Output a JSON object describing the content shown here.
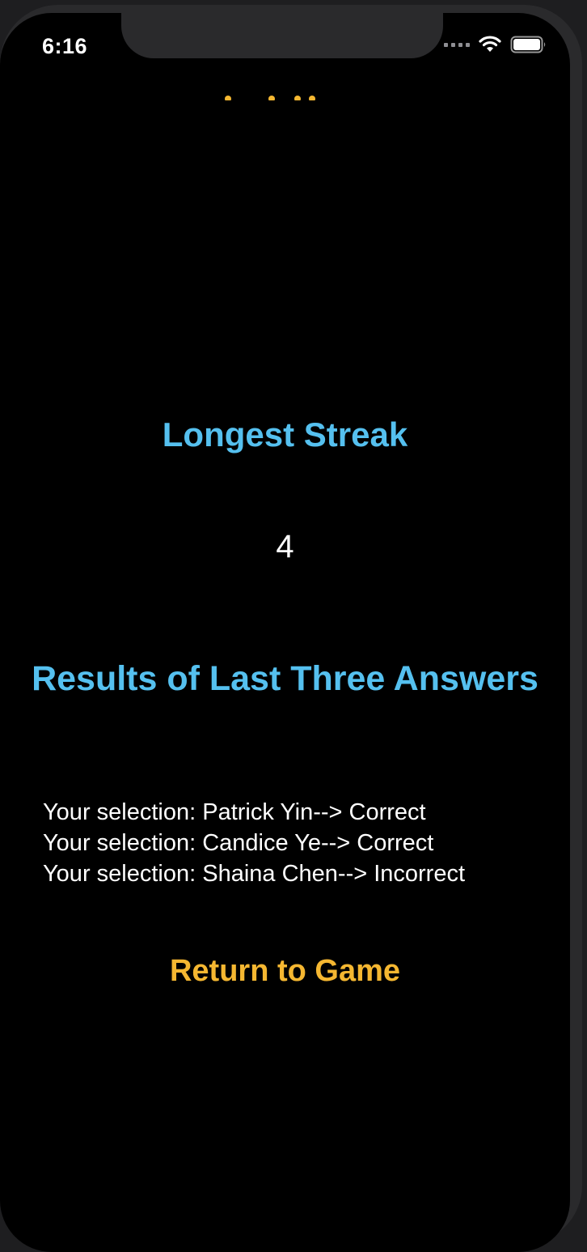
{
  "status_bar": {
    "time": "6:16",
    "icons": [
      "cellular-signal-icon",
      "wifi-icon",
      "battery-icon"
    ]
  },
  "stats": {
    "longest_streak_label": "Longest Streak",
    "longest_streak_value": "4",
    "results_heading": "Results of Last Three Answers",
    "results": [
      "Your selection: Patrick Yin--> Correct",
      "Your selection: Candice Ye--> Correct",
      "Your selection: Shaina Chen--> Incorrect"
    ]
  },
  "actions": {
    "return_label": "Return to Game"
  },
  "colors": {
    "heading": "#55c0ef",
    "accent": "#f5b731",
    "background": "#000000",
    "text": "#ffffff"
  }
}
